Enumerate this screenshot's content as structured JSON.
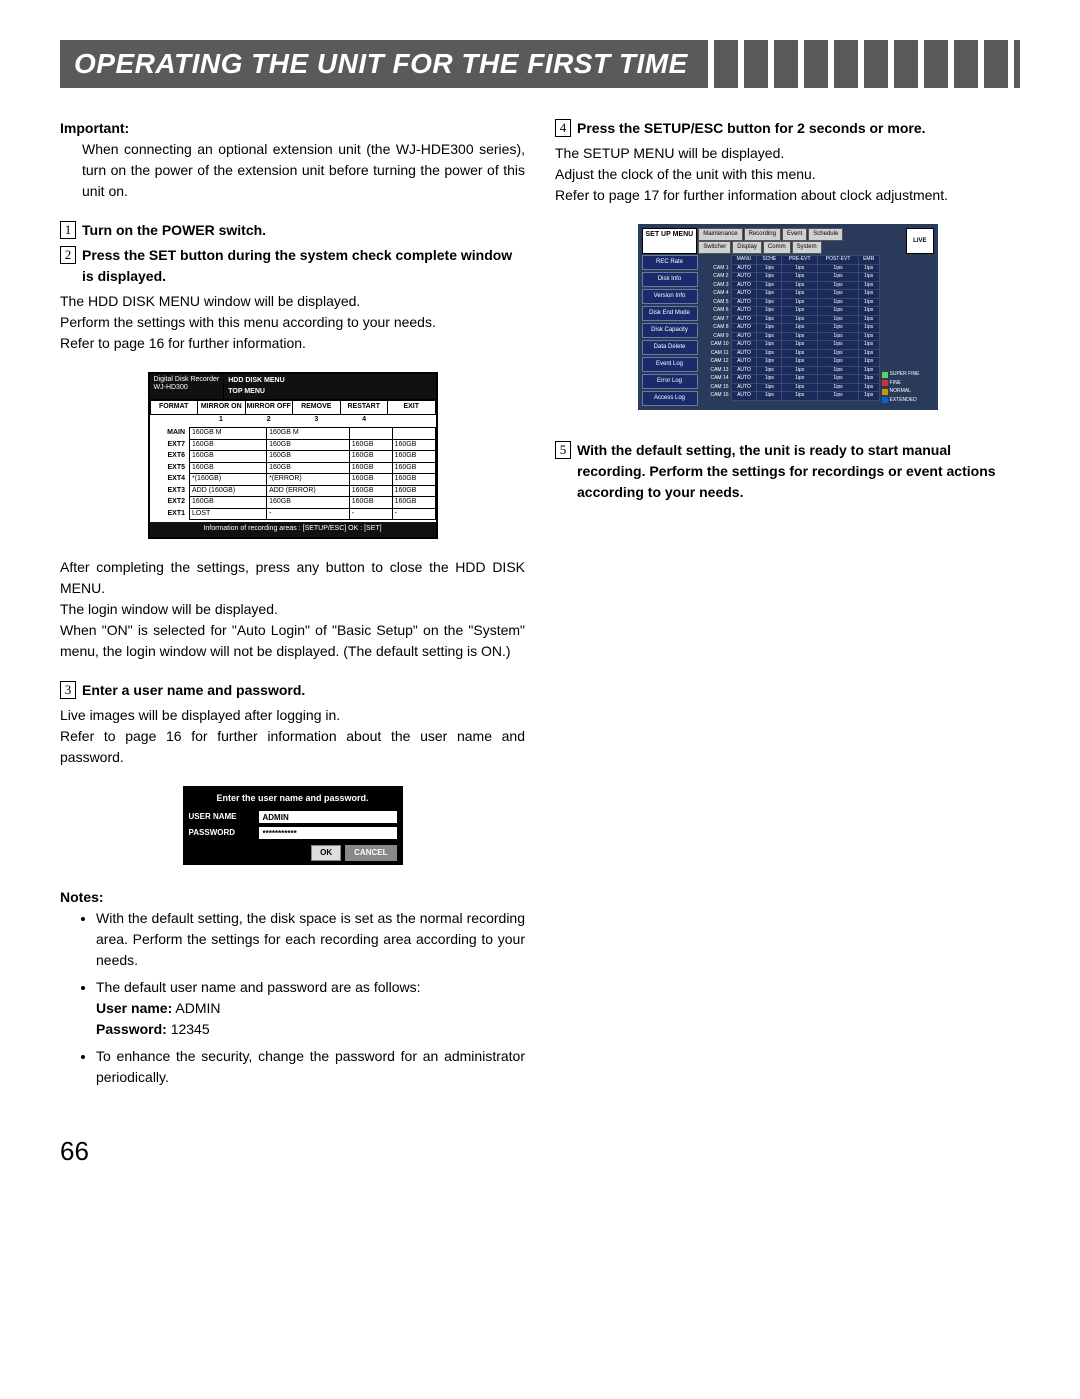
{
  "header": {
    "title": "OPERATING THE UNIT FOR THE FIRST TIME"
  },
  "page_number": "66",
  "left": {
    "important_label": "Important:",
    "important_text": "When connecting an optional extension unit (the WJ-HDE300 series), turn on the power of the extension unit before turning the power of this unit on.",
    "step1": {
      "num": "1",
      "title": "Turn on the POWER switch."
    },
    "step2": {
      "num": "2",
      "title": "Press the SET button during the system check complete window is displayed.",
      "p1": "The HDD DISK MENU window will be displayed.",
      "p2": "Perform the settings with this menu according to your needs.",
      "p3": "Refer to page 16 for further information."
    },
    "after1": "After completing the settings, press any button to close the HDD DISK MENU.",
    "after2": "The login window will be displayed.",
    "after3": "When \"ON\" is selected for \"Auto Login\" of \"Basic Setup\" on the \"System\" menu, the login window will not be displayed. (The default setting is ON.)",
    "step3": {
      "num": "3",
      "title": "Enter a user name and password.",
      "p1": "Live images will be displayed after logging in.",
      "p2": "Refer to page 16 for further information about the user name and password."
    },
    "notes_label": "Notes:",
    "note1": "With the default setting, the disk space is set as the normal recording area. Perform the settings for each recording area according to your needs.",
    "note2": "The default user name and password are as follows:",
    "note2_user_label": "User name:",
    "note2_user_value": " ADMIN",
    "note2_pass_label": "Password:",
    "note2_pass_value": " 12345",
    "note3": "To enhance the security, change the password for an administrator periodically."
  },
  "right": {
    "step4": {
      "num": "4",
      "title": "Press the SETUP/ESC button for 2 seconds or more.",
      "p1": "The SETUP MENU will be displayed.",
      "p2": "Adjust the clock of the unit with this menu.",
      "p3": "Refer to page 17 for further information about clock adjustment."
    },
    "step5": {
      "num": "5",
      "title": "With the default setting, the unit is ready to start manual recording. Perform the settings for recordings or event actions according to your needs."
    }
  },
  "hdd": {
    "recorder1": "Digital Disk Recorder",
    "recorder2": "WJ-HD300",
    "menu1": "HDD DISK MENU",
    "menu2": "TOP MENU",
    "tabs": [
      "FORMAT",
      "MIRROR ON",
      "MIRROR OFF",
      "REMOVE",
      "RESTART",
      "EXIT"
    ],
    "nums": [
      "",
      "1",
      "2",
      "3",
      "4",
      ""
    ],
    "rows": [
      {
        "lab": "MAIN",
        "c": [
          "160GB M",
          "160GB M",
          "",
          ""
        ]
      },
      {
        "lab": "EXT7",
        "c": [
          "160GB",
          "160GB",
          "160GB",
          "160GB"
        ]
      },
      {
        "lab": "EXT6",
        "c": [
          "160GB",
          "160GB",
          "160GB",
          "160GB"
        ]
      },
      {
        "lab": "EXT5",
        "c": [
          "160GB",
          "160GB",
          "160GB",
          "160GB"
        ]
      },
      {
        "lab": "EXT4",
        "c": [
          "*(160GB)",
          "*(ERROR)",
          "160GB",
          "160GB"
        ]
      },
      {
        "lab": "EXT3",
        "c": [
          "ADD (160GB)",
          "ADD (ERROR)",
          "160GB",
          "160GB"
        ]
      },
      {
        "lab": "EXT2",
        "c": [
          "160GB",
          "160GB",
          "160GB",
          "160GB"
        ]
      },
      {
        "lab": "EXT1",
        "c": [
          "LOST",
          "-",
          "-",
          "-"
        ]
      }
    ],
    "footer": "Information of recording areas : [SETUP/ESC] OK : [SET]"
  },
  "login": {
    "title": "Enter the user name and password.",
    "user_label": "USER NAME",
    "user_value": "ADMIN",
    "pass_label": "PASSWORD",
    "pass_value": "***********",
    "ok": "OK",
    "cancel": "CANCEL"
  },
  "setup": {
    "label": "SET UP MENU",
    "tabs_row1": [
      "Maintenance",
      "Recording",
      "Event",
      "Schedule"
    ],
    "tabs_row2": [
      "Switcher",
      "Display",
      "Comm",
      "System"
    ],
    "live": "LIVE",
    "side": [
      "REC Rate",
      "Disk Info",
      "Version Info",
      "Disk End Mode",
      "Disk Capacity",
      "Data Delete",
      "Event Log",
      "Error Log",
      "Access Log"
    ],
    "cols": [
      "MANU",
      "SCHE",
      "PRE-EVT",
      "POST-EVT",
      "EMR"
    ],
    "rows": [
      "CAM 1",
      "CAM 2",
      "CAM 3",
      "CAM 4",
      "CAM 5",
      "CAM 6",
      "CAM 7",
      "CAM 8",
      "CAM 9",
      "CAM 10",
      "CAM 11",
      "CAM 12",
      "CAM 13",
      "CAM 14",
      "CAM 15",
      "CAM 16"
    ],
    "cell_a": "AUTO",
    "cell_b": "1ips",
    "legend": [
      "SUPER FINE",
      "FINE",
      "NORMAL",
      "EXTENDED"
    ]
  }
}
